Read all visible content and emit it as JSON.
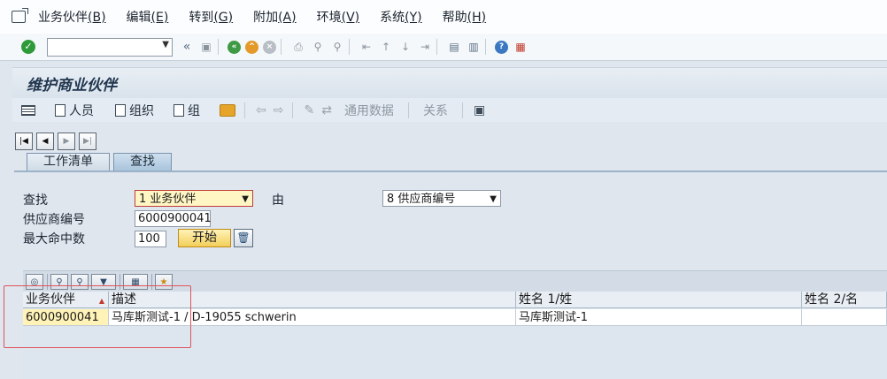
{
  "menu": [
    {
      "label": "业务伙伴",
      "key": "(B)"
    },
    {
      "label": "编辑",
      "key": "(E)"
    },
    {
      "label": "转到",
      "key": "(G)"
    },
    {
      "label": "附加",
      "key": "(A)"
    },
    {
      "label": "环境",
      "key": "(V)"
    },
    {
      "label": "系统",
      "key": "(Y)"
    },
    {
      "label": "帮助",
      "key": "(H)"
    }
  ],
  "command_field": {
    "value": ""
  },
  "title": "维护商业伙伴",
  "app_toolbar": {
    "person": "人员",
    "org": "组织",
    "group": "组",
    "general_data": "通用数据",
    "relations": "关系"
  },
  "tabs": {
    "worklist": "工作清单",
    "find": "查找"
  },
  "form": {
    "find_label": "查找",
    "find_value": "1 业务伙伴",
    "by_label": "由",
    "by_value": "8 供应商编号",
    "vendor_label": "供应商编号",
    "vendor_value": "6000900041",
    "max_hits_label": "最大命中数",
    "max_hits_value": "100",
    "start_button": "开始"
  },
  "grid": {
    "columns": [
      "业务伙伴",
      "描述",
      "姓名 1/姓",
      "姓名 2/名"
    ],
    "rows": [
      [
        "6000900041",
        "马库斯测试-1 / D-19055 schwerin",
        "马库斯测试-1",
        ""
      ]
    ]
  },
  "colors": {
    "required_border": "#c03a3a",
    "highlight": "#e0525a",
    "key_cell": "#fff3b8"
  }
}
